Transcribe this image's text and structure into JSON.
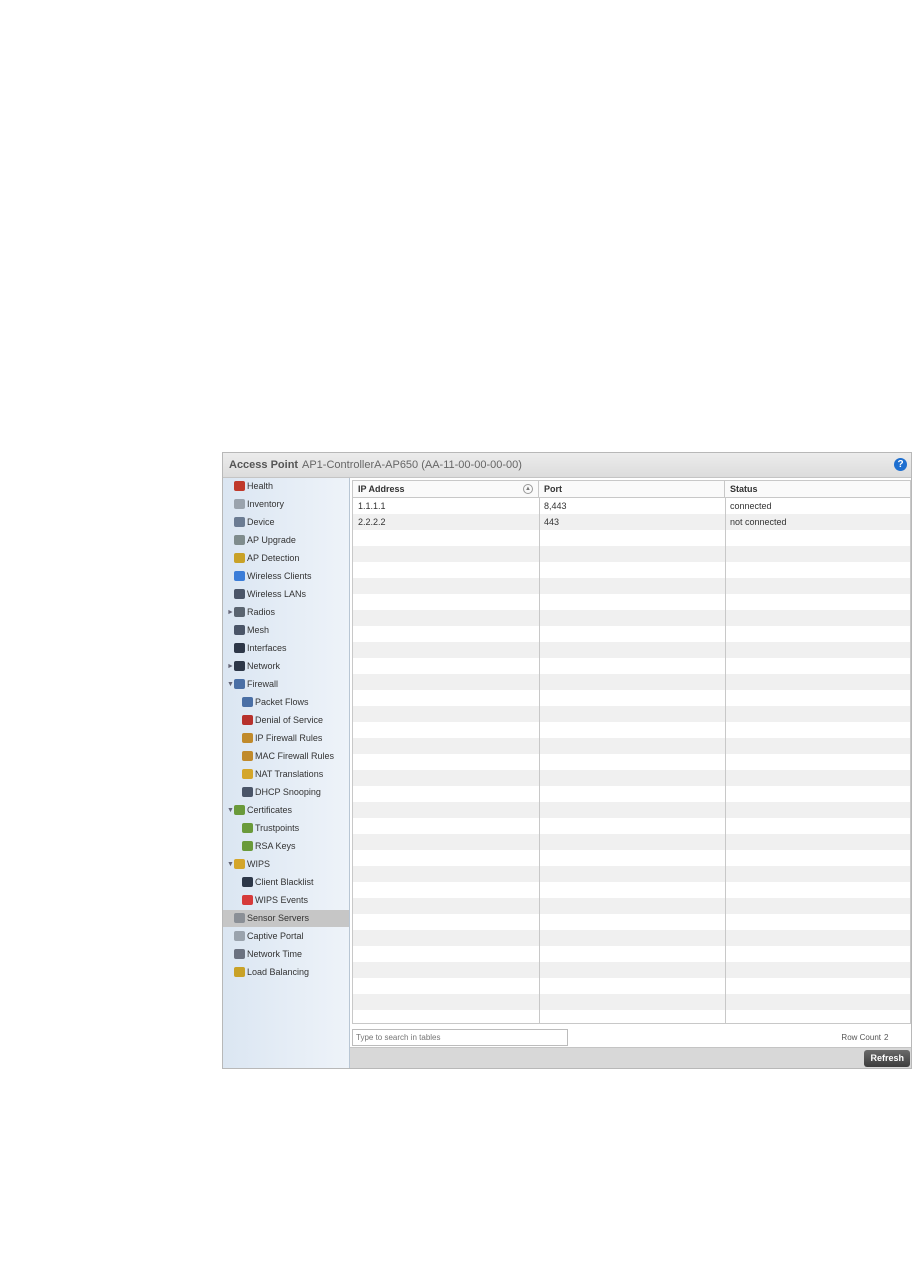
{
  "header": {
    "title": "Access Point",
    "subtitle": "AP1-ControllerA-AP650 (AA-11-00-00-00-00)",
    "help_label": "?"
  },
  "sidebar": {
    "items": [
      {
        "label": "Health",
        "icon": "health-icon",
        "color": "#c0392b",
        "level": 0,
        "arrow": ""
      },
      {
        "label": "Inventory",
        "icon": "inventory-icon",
        "color": "#9aa3ad",
        "level": 0,
        "arrow": ""
      },
      {
        "label": "Device",
        "icon": "device-icon",
        "color": "#6b7c93",
        "level": 0,
        "arrow": ""
      },
      {
        "label": "AP Upgrade",
        "icon": "ap-upgrade-icon",
        "color": "#7f8c8d",
        "level": 0,
        "arrow": ""
      },
      {
        "label": "AP Detection",
        "icon": "ap-detection-icon",
        "color": "#c9a227",
        "level": 0,
        "arrow": ""
      },
      {
        "label": "Wireless Clients",
        "icon": "wireless-clients-icon",
        "color": "#3b7dd8",
        "level": 0,
        "arrow": ""
      },
      {
        "label": "Wireless LANs",
        "icon": "wireless-lans-icon",
        "color": "#4a5568",
        "level": 0,
        "arrow": ""
      },
      {
        "label": "Radios",
        "icon": "radios-icon",
        "color": "#5a6470",
        "level": 0,
        "arrow": "►"
      },
      {
        "label": "Mesh",
        "icon": "mesh-icon",
        "color": "#4a5568",
        "level": 0,
        "arrow": ""
      },
      {
        "label": "Interfaces",
        "icon": "interfaces-icon",
        "color": "#2d3748",
        "level": 0,
        "arrow": ""
      },
      {
        "label": "Network",
        "icon": "network-icon",
        "color": "#2d3748",
        "level": 0,
        "arrow": "►"
      },
      {
        "label": "Firewall",
        "icon": "firewall-icon",
        "color": "#4a6fa5",
        "level": 0,
        "arrow": "▼"
      },
      {
        "label": "Packet Flows",
        "icon": "packet-flows-icon",
        "color": "#4a6fa5",
        "level": 1,
        "arrow": ""
      },
      {
        "label": "Denial of Service",
        "icon": "denial-of-service-icon",
        "color": "#b7312c",
        "level": 1,
        "arrow": ""
      },
      {
        "label": "IP Firewall Rules",
        "icon": "ip-firewall-rules-icon",
        "color": "#c08a2b",
        "level": 1,
        "arrow": ""
      },
      {
        "label": "MAC Firewall Rules",
        "icon": "mac-firewall-rules-icon",
        "color": "#c08a2b",
        "level": 1,
        "arrow": ""
      },
      {
        "label": "NAT Translations",
        "icon": "nat-translations-icon",
        "color": "#d4a62a",
        "level": 1,
        "arrow": ""
      },
      {
        "label": "DHCP Snooping",
        "icon": "dhcp-snooping-icon",
        "color": "#4a5568",
        "level": 1,
        "arrow": ""
      },
      {
        "label": "Certificates",
        "icon": "certificates-icon",
        "color": "#6a9a3a",
        "level": 0,
        "arrow": "▼"
      },
      {
        "label": "Trustpoints",
        "icon": "trustpoints-icon",
        "color": "#6a9a3a",
        "level": 1,
        "arrow": ""
      },
      {
        "label": "RSA Keys",
        "icon": "rsa-keys-icon",
        "color": "#6a9a3a",
        "level": 1,
        "arrow": ""
      },
      {
        "label": "WIPS",
        "icon": "wips-icon",
        "color": "#d4a62a",
        "level": 0,
        "arrow": "▼"
      },
      {
        "label": "Client Blacklist",
        "icon": "client-blacklist-icon",
        "color": "#2d3748",
        "level": 1,
        "arrow": ""
      },
      {
        "label": "WIPS Events",
        "icon": "wips-events-icon",
        "color": "#d63a3a",
        "level": 1,
        "arrow": ""
      },
      {
        "label": "Sensor Servers",
        "icon": "sensor-servers-icon",
        "color": "#8a8f96",
        "level": 0,
        "arrow": "",
        "active": true
      },
      {
        "label": "Captive Portal",
        "icon": "captive-portal-icon",
        "color": "#9aa3ad",
        "level": 0,
        "arrow": ""
      },
      {
        "label": "Network Time",
        "icon": "network-time-icon",
        "color": "#6b7280",
        "level": 0,
        "arrow": ""
      },
      {
        "label": "Load Balancing",
        "icon": "load-balancing-icon",
        "color": "#c9a227",
        "level": 0,
        "arrow": ""
      }
    ]
  },
  "table": {
    "columns": [
      "IP Address",
      "Port",
      "Status"
    ],
    "rows": [
      [
        "1.1.1.1",
        "8,443",
        "connected"
      ],
      [
        "2.2.2.2",
        "443",
        "not connected"
      ]
    ]
  },
  "footer": {
    "search_placeholder": "Type to search in tables",
    "row_count_label": "Row Count",
    "row_count_value": "2",
    "refresh_label": "Refresh"
  }
}
